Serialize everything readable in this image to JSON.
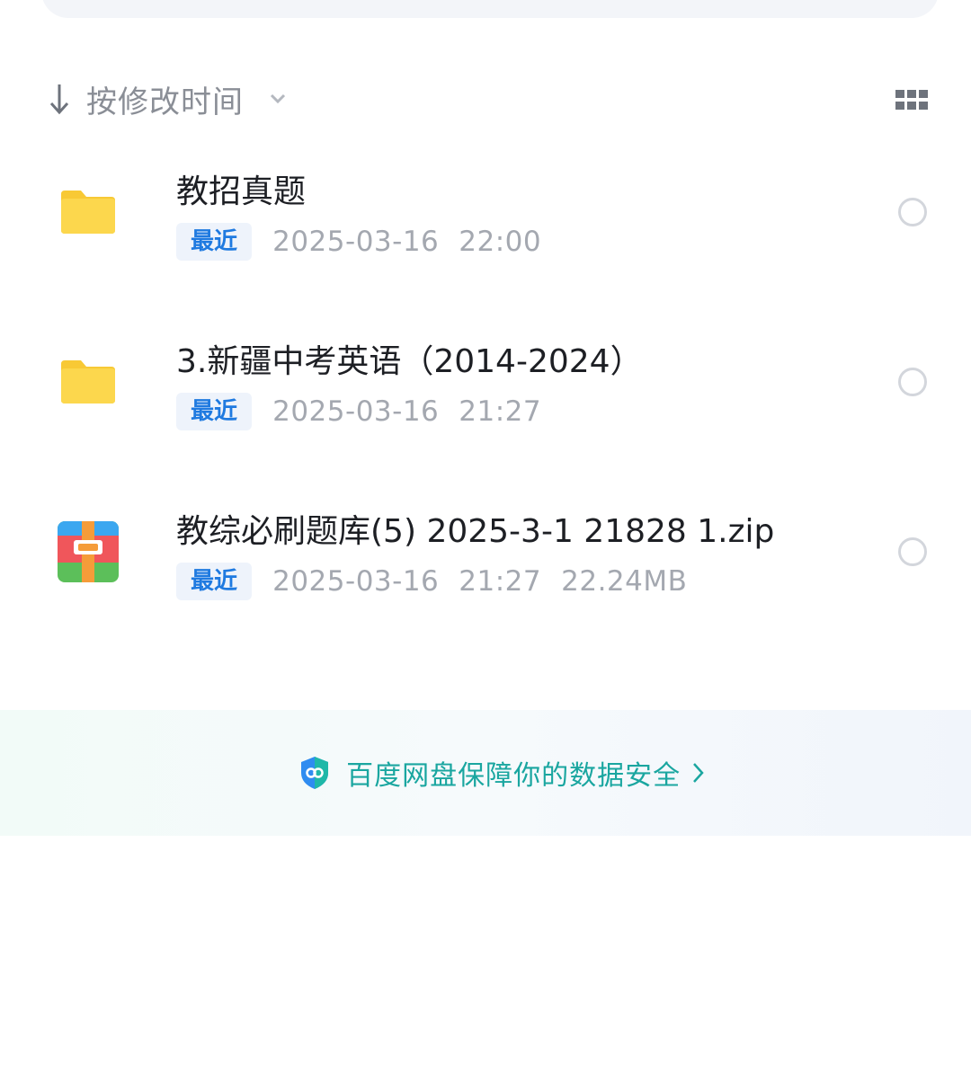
{
  "sort": {
    "label": "按修改时间",
    "direction_icon": "arrow-down-icon",
    "dropdown_icon": "chevron-down-icon",
    "view_toggle_icon": "grid-view-icon"
  },
  "files": [
    {
      "name": "教招真题",
      "type_icon": "folder-icon",
      "badge": "最近",
      "date": "2025-03-16",
      "time": "22:00",
      "size": ""
    },
    {
      "name": "3.新疆中考英语（2014-2024）",
      "type_icon": "folder-icon",
      "badge": "最近",
      "date": "2025-03-16",
      "time": "21:27",
      "size": ""
    },
    {
      "name": "教综必刷题库(5) 2025-3-1 21828 1.zip",
      "type_icon": "archive-zip-icon",
      "badge": "最近",
      "date": "2025-03-16",
      "time": "21:27",
      "size": "22.24MB"
    }
  ],
  "safety": {
    "text": "百度网盘保障你的数据安全",
    "icon": "shield-icon",
    "accent_color": "#1aa6a0"
  },
  "colors": {
    "folder": "#fcd34d",
    "badge_text": "#1f7ae0",
    "badge_bg": "#eef3fb"
  }
}
